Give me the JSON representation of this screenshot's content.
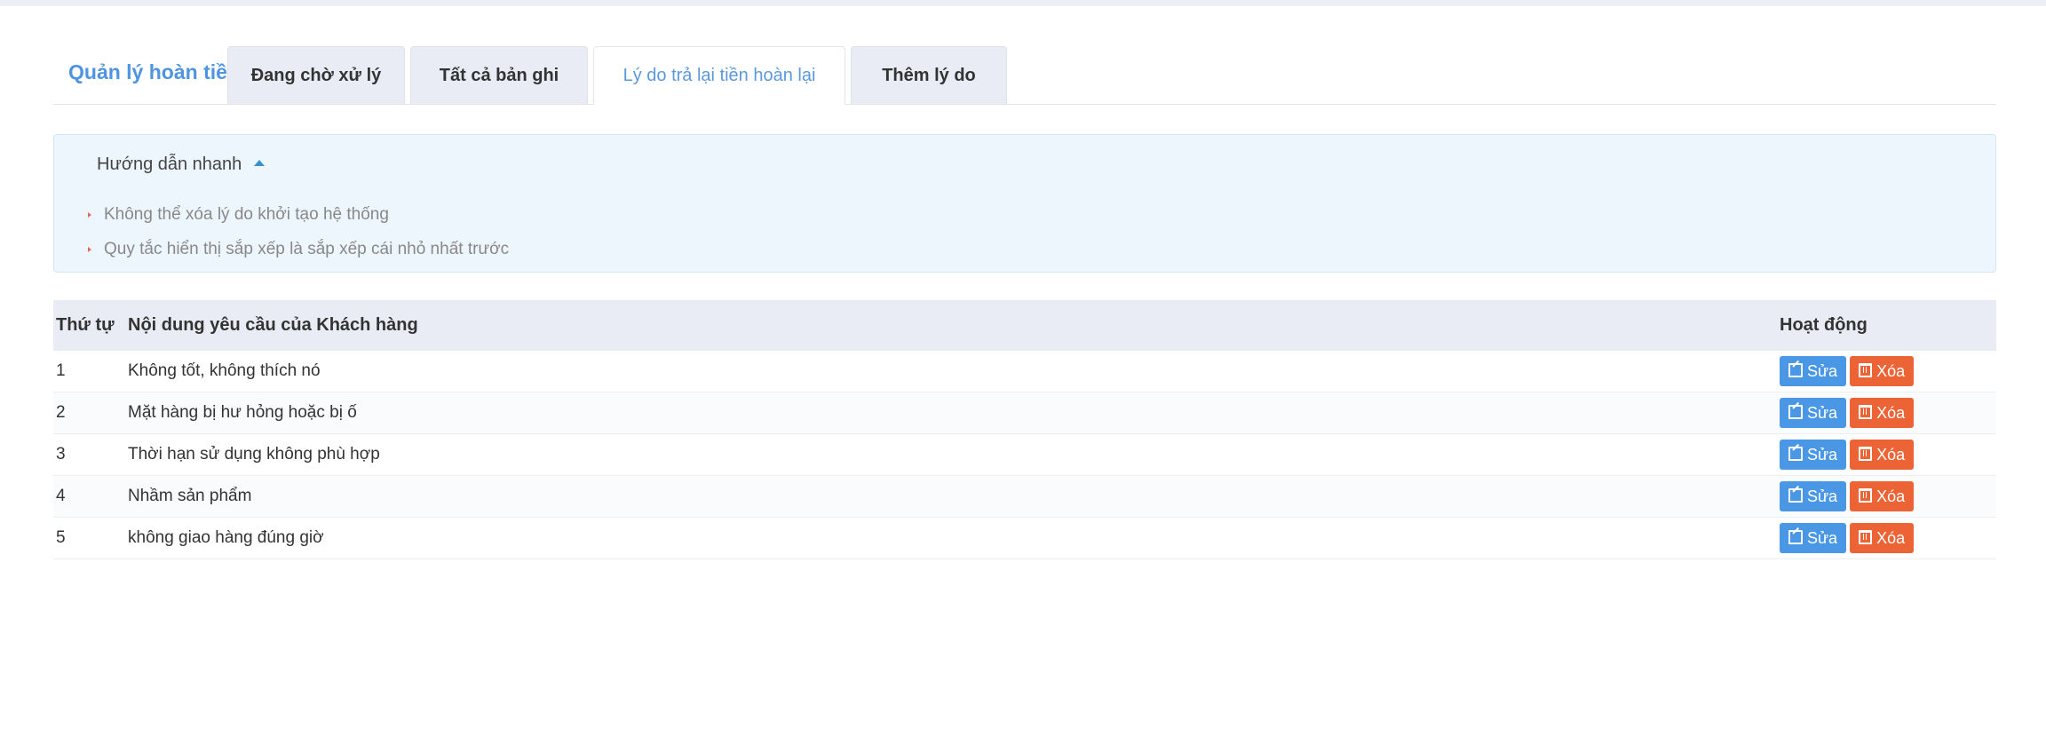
{
  "header": {
    "title": "Quản lý hoàn tiền",
    "tabs": [
      {
        "label": "Đang chờ xử lý"
      },
      {
        "label": "Tất cả bản ghi"
      },
      {
        "label": "Lý do trả lại tiền hoàn lại"
      },
      {
        "label": "Thêm lý do"
      }
    ],
    "active_tab": "Lý do trả lại tiền hoàn lại"
  },
  "guide": {
    "title": "Hướng dẫn nhanh",
    "items": [
      "Không thể xóa lý do khởi tạo hệ thống",
      "Quy tắc hiển thị sắp xếp là sắp xếp cái nhỏ nhất trước"
    ]
  },
  "table": {
    "headers": {
      "order": "Thứ tự",
      "content": "Nội dung yêu cầu của Khách hàng",
      "actions": "Hoạt động"
    },
    "rows": [
      {
        "order": "1",
        "content": "Không tốt, không thích nó"
      },
      {
        "order": "2",
        "content": "Mặt hàng bị hư hỏng hoặc bị ố"
      },
      {
        "order": "3",
        "content": "Thời hạn sử dụng không phù hợp"
      },
      {
        "order": "4",
        "content": "Nhầm sản phẩm"
      },
      {
        "order": "5",
        "content": "không giao hàng đúng giờ"
      }
    ],
    "edit_label": "Sửa",
    "delete_label": "Xóa"
  },
  "colors": {
    "accent": "#4f94e0",
    "edit_button": "#4a97e6",
    "delete_button": "#ec6436",
    "guide_bg": "#eef6fd"
  },
  "icons": {
    "edit": "edit-icon",
    "delete": "trash-icon",
    "guide_toggle": "caret-up-icon"
  }
}
